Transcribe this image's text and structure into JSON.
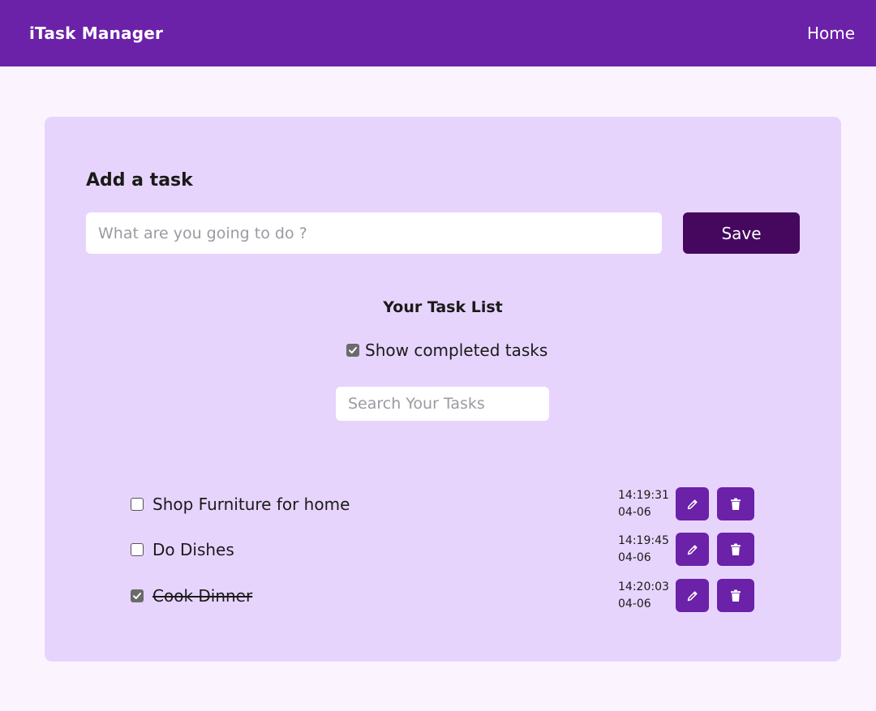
{
  "navbar": {
    "brand": "iTask Manager",
    "home_link": "Home",
    "bg_color": "#6b21a8"
  },
  "add_task": {
    "title": "Add a task",
    "input_value": "",
    "input_placeholder": "What are you going to do ?",
    "save_label": "Save"
  },
  "task_list": {
    "title": "Your Task List",
    "show_completed_label": "Show completed tasks",
    "show_completed_checked": true,
    "search_value": "",
    "search_placeholder": "Search Your Tasks",
    "tasks": [
      {
        "text": "Shop Furniture for home",
        "completed": false,
        "time": "14:19:31",
        "date": "04-06"
      },
      {
        "text": "Do Dishes",
        "completed": false,
        "time": "14:19:45",
        "date": "04-06"
      },
      {
        "text": "Cook Dinner",
        "completed": true,
        "time": "14:20:03",
        "date": "04-06"
      }
    ],
    "icons": {
      "edit": "pencil-icon",
      "delete": "trash-icon"
    }
  },
  "colors": {
    "accent": "#6b21a8",
    "save_button": "#45085e",
    "card_bg": "#e7d4fc",
    "page_bg": "#fbf4fe"
  }
}
